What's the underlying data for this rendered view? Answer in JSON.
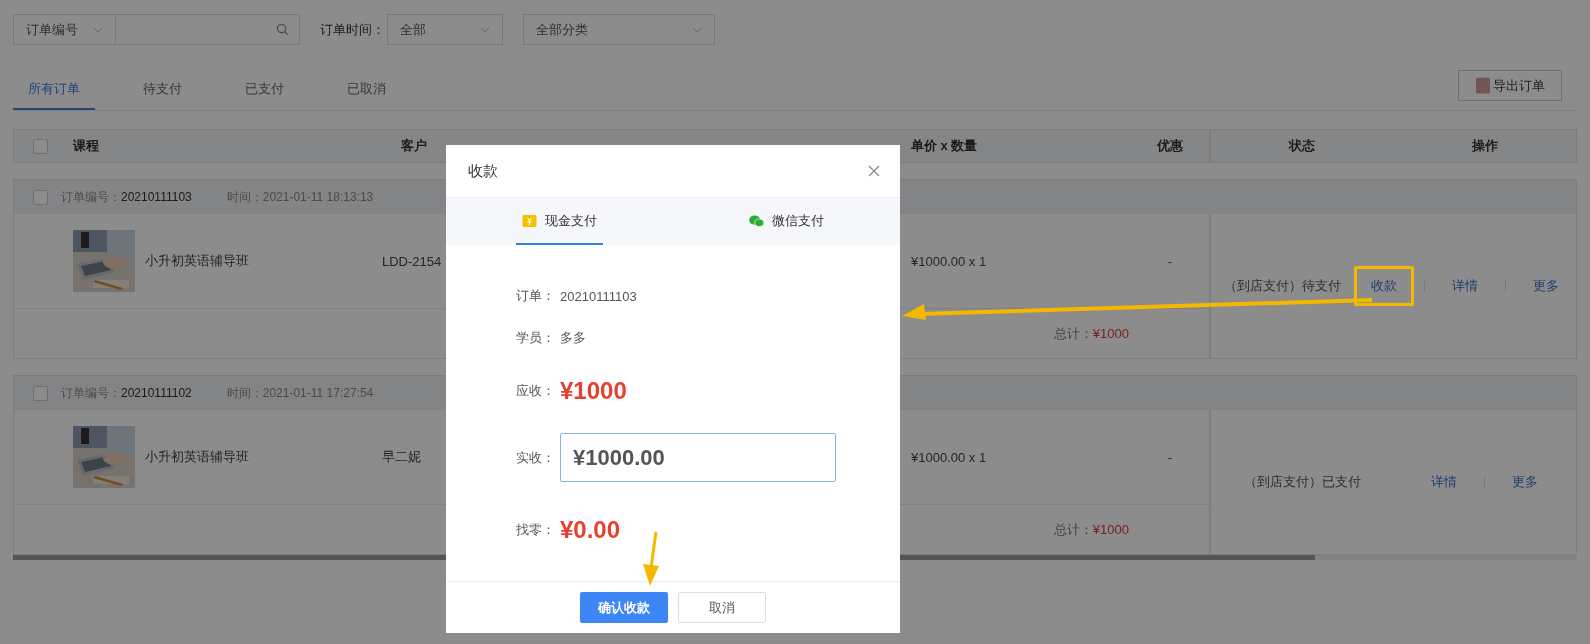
{
  "filters": {
    "field_select": "订单编号",
    "time_label": "订单时间：",
    "time_select": "全部",
    "category_select": "全部分类"
  },
  "tabs": [
    {
      "label": "所有订单",
      "selected": true
    },
    {
      "label": "待支付",
      "selected": false
    },
    {
      "label": "已支付",
      "selected": false
    },
    {
      "label": "已取消",
      "selected": false
    }
  ],
  "export_button": "导出订单",
  "table": {
    "select_all": {
      "checked": false
    },
    "columns": [
      "课程",
      "客户",
      "单价 x 数量",
      "优惠",
      "状态",
      "操作"
    ]
  },
  "orders": [
    {
      "checked": false,
      "order_no_label": "订单编号：",
      "order_no": "20210111103",
      "time_label": "时间：",
      "time": "2021-01-11 18:13:13",
      "course": "小升初英语辅导班",
      "customer": "LDD-2154",
      "price": "¥1000.00 x 1",
      "discount": "-",
      "total_label": "总计：",
      "total": "¥1000",
      "status": "（到店支付）待支付",
      "actions": [
        {
          "label": "收款",
          "highlighted": true
        },
        {
          "label": "详情",
          "highlighted": false
        },
        {
          "label": "更多",
          "highlighted": false
        }
      ]
    },
    {
      "checked": false,
      "order_no_label": "订单编号：",
      "order_no": "20210111102",
      "time_label": "时间：",
      "time": "2021-01-11 17:27:54",
      "course": "小升初英语辅导班",
      "customer": "早二妮",
      "price": "¥1000.00 x 1",
      "discount": "-",
      "total_label": "总计：",
      "total": "¥1000",
      "status": "（到店支付）已支付",
      "actions": [
        {
          "label": "详情",
          "highlighted": false
        },
        {
          "label": "更多",
          "highlighted": false
        }
      ]
    }
  ],
  "modal": {
    "title": "收款",
    "tabs": [
      {
        "label": "现金支付",
        "kind": "cash",
        "selected": true
      },
      {
        "label": "微信支付",
        "kind": "wechat",
        "selected": false
      }
    ],
    "fields": [
      {
        "kind": "text",
        "label": "订单：",
        "value": "20210111103"
      },
      {
        "kind": "text",
        "label": "学员：",
        "value": "多多"
      },
      {
        "kind": "amount",
        "label": "应收：",
        "value": "¥1000"
      },
      {
        "kind": "input",
        "label": "实收：",
        "value": "¥1000.00"
      },
      {
        "kind": "amount",
        "label": "找零：",
        "value": "¥0.00"
      }
    ],
    "confirm_button": "确认收款",
    "cancel_button": "取消"
  }
}
